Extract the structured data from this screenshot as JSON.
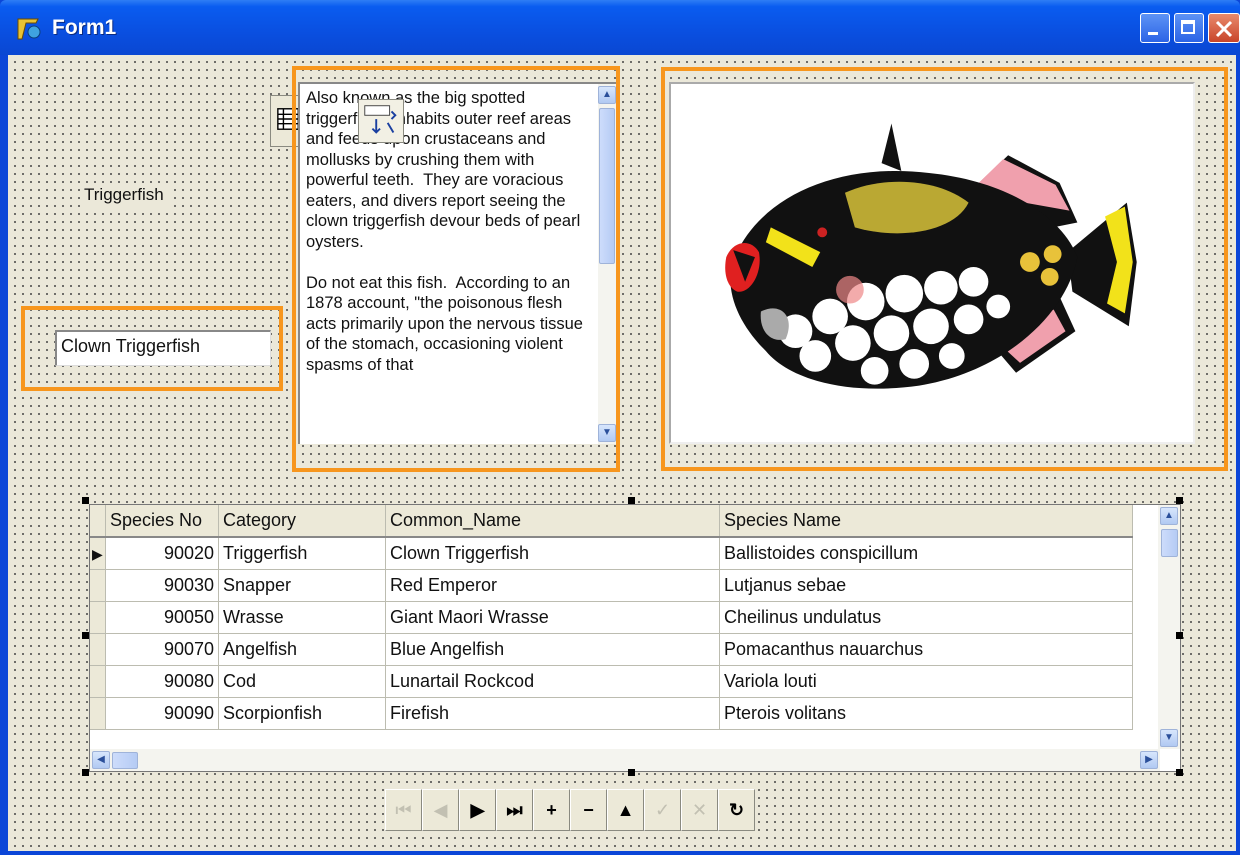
{
  "window": {
    "title": "Form1",
    "controls": [
      "minimize-icon",
      "maximize-icon",
      "close-icon"
    ]
  },
  "colors": {
    "highlight": "#f7961d",
    "titlebar": "#0a4fe0",
    "form_bg": "#ebe8d9"
  },
  "label_category": "Triggerfish",
  "edit_common_name": "Clown Triggerfish",
  "memo_text": "Also known as the big spotted triggerfish.  Inhabits outer reef areas and feeds upon crustaceans and mollusks by crushing them with powerful teeth.  They are voracious eaters, and divers report seeing the clown triggerfish devour beds of pearl oysters.\n\nDo not eat this fish.  According to an 1878 account, \"the poisonous flesh acts primarily upon the nervous tissue of the stomach, occasioning violent spasms of that",
  "image": {
    "subject": "clown triggerfish"
  },
  "grid": {
    "columns": [
      "Species No",
      "Category",
      "Common_Name",
      "Species Name"
    ],
    "rows": [
      [
        "90020",
        "Triggerfish",
        "Clown Triggerfish",
        "Ballistoides conspicillum"
      ],
      [
        "90030",
        "Snapper",
        "Red Emperor",
        "Lutjanus sebae"
      ],
      [
        "90050",
        "Wrasse",
        "Giant Maori Wrasse",
        "Cheilinus undulatus"
      ],
      [
        "90070",
        "Angelfish",
        "Blue Angelfish",
        "Pomacanthus nauarchus"
      ],
      [
        "90080",
        "Cod",
        "Lunartail Rockcod",
        "Variola louti"
      ],
      [
        "90090",
        "Scorpionfish",
        "Firefish",
        "Pterois volitans"
      ]
    ],
    "current_row": 0
  },
  "navigator": {
    "buttons": [
      {
        "name": "first",
        "glyph": "⏮",
        "enabled": false
      },
      {
        "name": "prior",
        "glyph": "◀",
        "enabled": false
      },
      {
        "name": "next",
        "glyph": "▶",
        "enabled": true
      },
      {
        "name": "last",
        "glyph": "⏭",
        "enabled": true
      },
      {
        "name": "insert",
        "glyph": "+",
        "enabled": true
      },
      {
        "name": "delete",
        "glyph": "−",
        "enabled": true
      },
      {
        "name": "edit",
        "glyph": "▲",
        "enabled": true
      },
      {
        "name": "post",
        "glyph": "✓",
        "enabled": false
      },
      {
        "name": "cancel",
        "glyph": "✕",
        "enabled": false
      },
      {
        "name": "refresh",
        "glyph": "↻",
        "enabled": true
      }
    ]
  }
}
